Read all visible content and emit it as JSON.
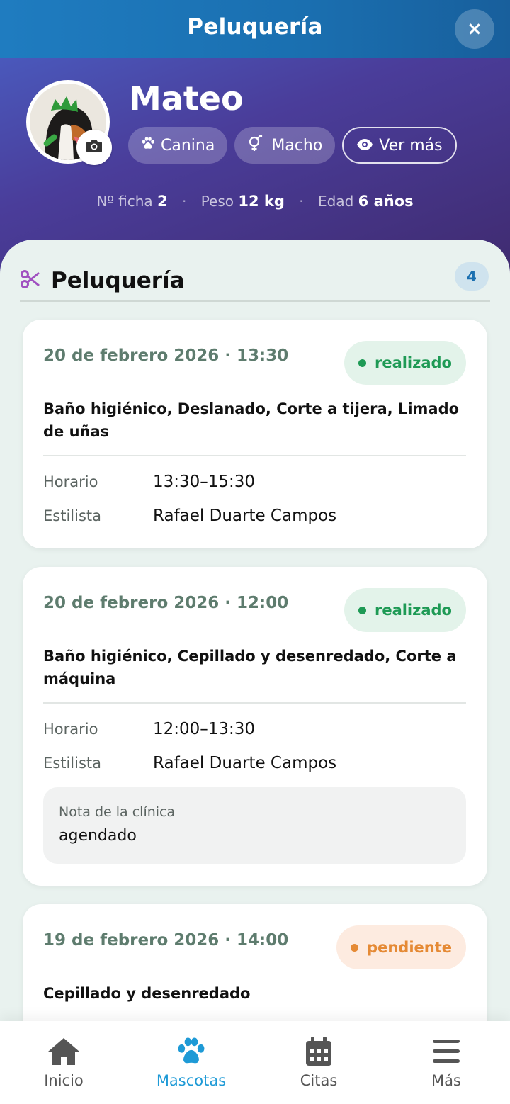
{
  "header": {
    "title": "Peluquería",
    "close_label": "×"
  },
  "pet": {
    "name": "Mateo",
    "chips": [
      {
        "icon": "paw-icon",
        "label": "Canina"
      },
      {
        "icon": "gender-icon",
        "label": "Macho"
      },
      {
        "icon": "eye-icon",
        "label": "Ver más"
      }
    ],
    "meta": {
      "ficha_label": "Nº ficha",
      "ficha_value": "2",
      "peso_label": "Peso",
      "peso_value": "12 kg",
      "edad_label": "Edad",
      "edad_value": "6 años"
    }
  },
  "section": {
    "title": "Peluquería",
    "count": "4",
    "icon": "scissors-icon"
  },
  "appointments": [
    {
      "date": "20 de febrero 2026 · 13:30",
      "status": "realizado",
      "services": "Baño higiénico, Deslanado, Corte a tijera, Limado de uñas",
      "horario_label": "Horario",
      "horario": "13:30–15:30",
      "estilista_label": "Estilista",
      "estilista": "Rafael Duarte Campos"
    },
    {
      "date": "20 de febrero 2026 · 12:00",
      "status": "realizado",
      "services": "Baño higiénico, Cepillado y desenredado, Corte a máquina",
      "horario_label": "Horario",
      "horario": "12:00–13:30",
      "estilista_label": "Estilista",
      "estilista": "Rafael Duarte Campos",
      "note_label": "Nota de la clínica",
      "note": "agendado"
    },
    {
      "date": "19 de febrero 2026 · 14:00",
      "status": "pendiente",
      "services": "Cepillado y desenredado"
    }
  ],
  "nav": [
    {
      "icon": "home-icon",
      "label": "Inicio",
      "active": false
    },
    {
      "icon": "paw-icon",
      "label": "Mascotas",
      "active": true
    },
    {
      "icon": "calendar-icon",
      "label": "Citas",
      "active": false
    },
    {
      "icon": "menu-icon",
      "label": "Más",
      "active": false
    }
  ],
  "colors": {
    "accent": "#1e9ad6",
    "done": "#1e9a55",
    "pending": "#e58a35",
    "section_icon": "#a050c0"
  }
}
